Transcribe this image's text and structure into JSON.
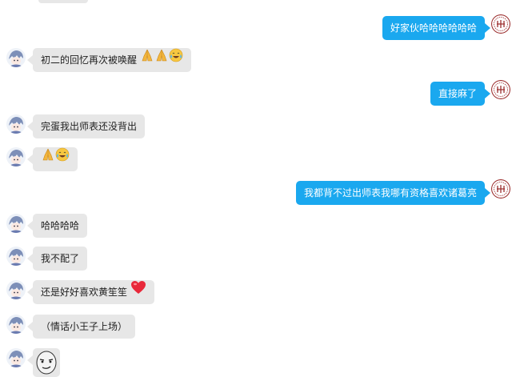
{
  "chat": {
    "colors": {
      "outgoing_bubble": "#1aa8ef",
      "incoming_bubble": "#e7e7e7"
    },
    "messages": [
      {
        "side": "out",
        "text": "好家伙哈哈哈哈哈哈"
      },
      {
        "side": "in",
        "text": "初二的回忆再次被唤醒",
        "emoji": [
          "folded-hands-icon",
          "folded-hands-icon",
          "tears-of-joy-icon"
        ]
      },
      {
        "side": "out",
        "text": "直接麻了"
      },
      {
        "side": "in",
        "text": "完蛋我出师表还没背出"
      },
      {
        "side": "in",
        "text": "",
        "emoji": [
          "folded-hands-icon",
          "tears-of-joy-icon"
        ]
      },
      {
        "side": "out",
        "text": "我都背不过出师表我哪有资格喜欢诸葛亮"
      },
      {
        "side": "in",
        "text": "哈哈哈哈"
      },
      {
        "side": "in",
        "text": "我不配了"
      },
      {
        "side": "in",
        "text": "还是好好喜欢黄笙笙",
        "emoji": [
          "red-heart-icon"
        ]
      },
      {
        "side": "in",
        "text": "（情话小王子上场）"
      },
      {
        "side": "in",
        "text": "",
        "sticker": "smirk-face-sticker"
      }
    ]
  }
}
